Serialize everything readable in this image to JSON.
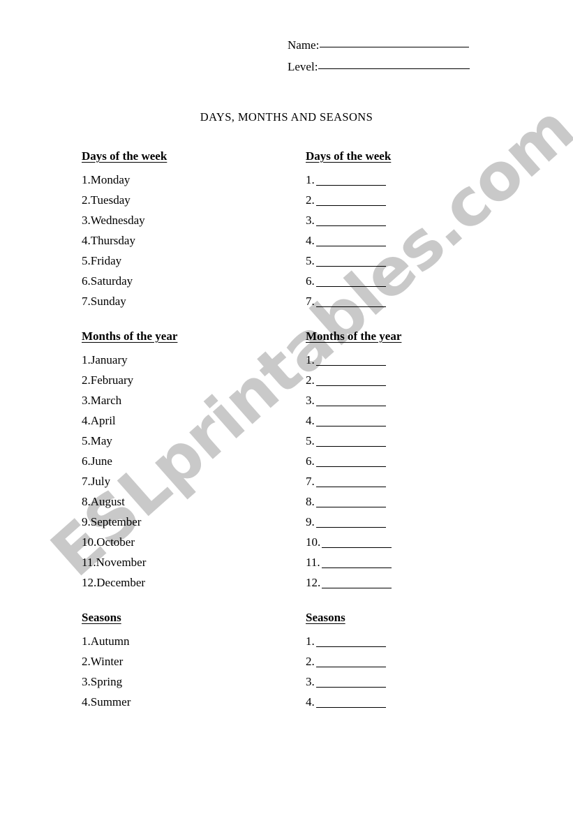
{
  "header": {
    "name_label": "Name:",
    "level_label": "Level:",
    "name_value": "",
    "level_value": ""
  },
  "title": "DAYS, MONTHS AND SEASONS",
  "watermark": {
    "text": "ESLprintables.com",
    "color": "#c9c9c9"
  },
  "sections": {
    "days": {
      "heading": "Days of the week",
      "answer_heading": "Days of the week",
      "items": [
        {
          "num": "1.",
          "text": "Monday"
        },
        {
          "num": "2.",
          "text": "Tuesday"
        },
        {
          "num": "3.",
          "text": "Wednesday"
        },
        {
          "num": "4.",
          "text": "Thursday"
        },
        {
          "num": "5.",
          "text": "Friday"
        },
        {
          "num": "6.",
          "text": "Saturday"
        },
        {
          "num": "7.",
          "text": "Sunday"
        }
      ],
      "answers": [
        {
          "num": "1.",
          "value": ""
        },
        {
          "num": "2.",
          "value": ""
        },
        {
          "num": "3.",
          "value": ""
        },
        {
          "num": "4.",
          "value": ""
        },
        {
          "num": "5.",
          "value": ""
        },
        {
          "num": "6.",
          "value": ""
        },
        {
          "num": "7.",
          "value": ""
        }
      ]
    },
    "months": {
      "heading": "Months of the year",
      "answer_heading": "Months of the year",
      "items": [
        {
          "num": "1.",
          "text": "January"
        },
        {
          "num": "2.",
          "text": "February"
        },
        {
          "num": "3.",
          "text": "March"
        },
        {
          "num": "4.",
          "text": "April"
        },
        {
          "num": "5.",
          "text": "May"
        },
        {
          "num": "6.",
          "text": "June"
        },
        {
          "num": "7.",
          "text": "July"
        },
        {
          "num": "8.",
          "text": "August"
        },
        {
          "num": "9.",
          "text": "September"
        },
        {
          "num": "10.",
          "text": "October"
        },
        {
          "num": "11.",
          "text": "November"
        },
        {
          "num": "12.",
          "text": "December"
        }
      ],
      "answers": [
        {
          "num": "1.",
          "value": ""
        },
        {
          "num": "2.",
          "value": ""
        },
        {
          "num": "3.",
          "value": ""
        },
        {
          "num": "4.",
          "value": ""
        },
        {
          "num": "5.",
          "value": ""
        },
        {
          "num": "6.",
          "value": ""
        },
        {
          "num": "7.",
          "value": ""
        },
        {
          "num": "8.",
          "value": ""
        },
        {
          "num": "9.",
          "value": ""
        },
        {
          "num": "10.",
          "value": ""
        },
        {
          "num": "11.",
          "value": ""
        },
        {
          "num": "12.",
          "value": ""
        }
      ]
    },
    "seasons": {
      "heading": "Seasons",
      "answer_heading": "Seasons",
      "items": [
        {
          "num": "1.",
          "text": "Autumn"
        },
        {
          "num": "2.",
          "text": "Winter"
        },
        {
          "num": "3.",
          "text": "Spring"
        },
        {
          "num": "4.",
          "text": "Summer"
        }
      ],
      "answers": [
        {
          "num": "1.",
          "value": ""
        },
        {
          "num": "2.",
          "value": ""
        },
        {
          "num": "3.",
          "value": ""
        },
        {
          "num": "4.",
          "value": ""
        }
      ]
    }
  }
}
